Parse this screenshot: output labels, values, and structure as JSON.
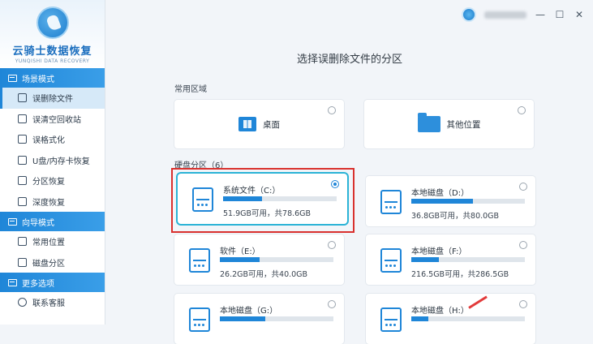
{
  "app": {
    "logo_title": "云骑士数据恢复",
    "logo_sub": "YUNQISHI DATA RECOVERY"
  },
  "sidebar": {
    "sections": [
      {
        "title": "场景模式",
        "items": [
          {
            "label": "误删除文件",
            "active": true
          },
          {
            "label": "误清空回收站",
            "active": false
          },
          {
            "label": "误格式化",
            "active": false
          },
          {
            "label": "U盘/内存卡恢复",
            "active": false
          },
          {
            "label": "分区恢复",
            "active": false
          },
          {
            "label": "深度恢复",
            "active": false
          }
        ]
      },
      {
        "title": "向导模式",
        "items": [
          {
            "label": "常用位置",
            "active": false
          },
          {
            "label": "磁盘分区",
            "active": false
          }
        ]
      },
      {
        "title": "更多选项",
        "items": [
          {
            "label": "联系客服",
            "active": false
          }
        ]
      }
    ]
  },
  "topbar": {
    "minimize": "—",
    "maximize": "☐",
    "close": "✕"
  },
  "main": {
    "title": "选择误删除文件的分区",
    "common_label": "常用区域",
    "common": [
      {
        "label": "桌面",
        "icon": "desktop-icon"
      },
      {
        "label": "其他位置",
        "icon": "folder-icon"
      }
    ],
    "disk_label": "硬盘分区（6）",
    "drives": [
      {
        "name": "系统文件（C:）",
        "size": "51.9GB可用，共78.6GB",
        "usage": 0.34,
        "selected": true
      },
      {
        "name": "本地磁盘（D:）",
        "size": "36.8GB可用，共80.0GB",
        "usage": 0.54,
        "selected": false
      },
      {
        "name": "软件（E:）",
        "size": "26.2GB可用，共40.0GB",
        "usage": 0.35,
        "selected": false
      },
      {
        "name": "本地磁盘（F:）",
        "size": "216.5GB可用，共286.5GB",
        "usage": 0.24,
        "selected": false
      },
      {
        "name": "本地磁盘（G:）",
        "size": "",
        "usage": 0.4,
        "selected": false
      },
      {
        "name": "本地磁盘（H:）",
        "size": "",
        "usage": 0.15,
        "selected": false
      }
    ]
  },
  "colors": {
    "accent": "#1f86d8",
    "highlight": "#d9312e"
  }
}
